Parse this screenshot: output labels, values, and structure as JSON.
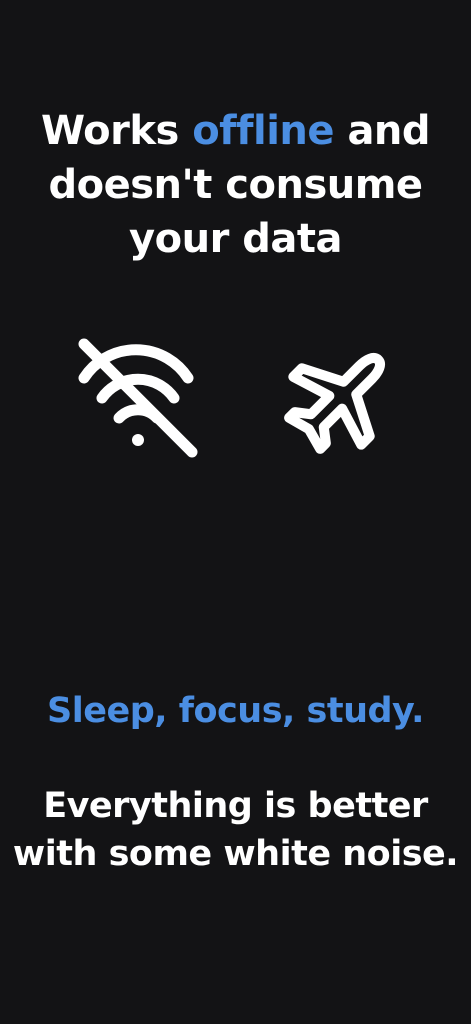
{
  "headline": {
    "before": "Works ",
    "highlight": "offline",
    "after": " and doesn't consume your data"
  },
  "icons": {
    "first": "wifi-off-icon",
    "second": "airplane-icon"
  },
  "tagline": "Sleep, focus, study.",
  "subtext": "Everything is better with some white noise.",
  "colors": {
    "background": "#131315",
    "accent": "#4b8ee2",
    "text": "#ffffff"
  }
}
